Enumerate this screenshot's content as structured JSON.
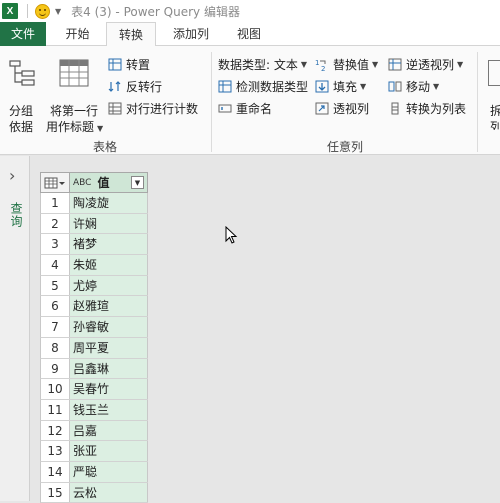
{
  "titlebar": {
    "logo": "X",
    "title": "表4 (3) - Power Query 编辑器"
  },
  "tabs": [
    {
      "label": "文件",
      "active": false
    },
    {
      "label": "开始",
      "active": false
    },
    {
      "label": "转换",
      "active": true
    },
    {
      "label": "添加列",
      "active": false
    },
    {
      "label": "视图",
      "active": false
    }
  ],
  "ribbon": {
    "table_group": {
      "label": "表格",
      "group_by": [
        "分组",
        "依据"
      ],
      "first_row_header": [
        "将第一行",
        "用作标题"
      ],
      "transpose": "转置",
      "reverse_rows": "反转行",
      "count_rows": "对行进行计数"
    },
    "any_column_group": {
      "label": "任意列",
      "data_type": "数据类型: 文本",
      "detect_type": "检测数据类型",
      "rename": "重命名",
      "replace_values": "替换值",
      "fill": "填充",
      "pivot": "透视列",
      "unpivot": "逆透视列",
      "move": "移动",
      "to_list": "转换为列表"
    },
    "overflow_label": [
      "拆",
      "列"
    ]
  },
  "side_panel": {
    "label": "查询"
  },
  "grid": {
    "column_header": "值",
    "type_badge": "ABC",
    "rows": [
      {
        "n": "1",
        "v": "陶凌旋"
      },
      {
        "n": "2",
        "v": "许娴"
      },
      {
        "n": "3",
        "v": "褚梦"
      },
      {
        "n": "4",
        "v": "朱姬"
      },
      {
        "n": "5",
        "v": "尤婷"
      },
      {
        "n": "6",
        "v": "赵雅瑄"
      },
      {
        "n": "7",
        "v": "孙睿敏"
      },
      {
        "n": "8",
        "v": "周平夏"
      },
      {
        "n": "9",
        "v": "吕鑫琳"
      },
      {
        "n": "10",
        "v": "吴春竹"
      },
      {
        "n": "11",
        "v": "钱玉兰"
      },
      {
        "n": "12",
        "v": "吕嘉"
      },
      {
        "n": "13",
        "v": "张亚"
      },
      {
        "n": "14",
        "v": "严聪"
      },
      {
        "n": "15",
        "v": "云松"
      }
    ]
  },
  "colors": {
    "accent": "#217346",
    "column_fill": "#dcefe2"
  }
}
